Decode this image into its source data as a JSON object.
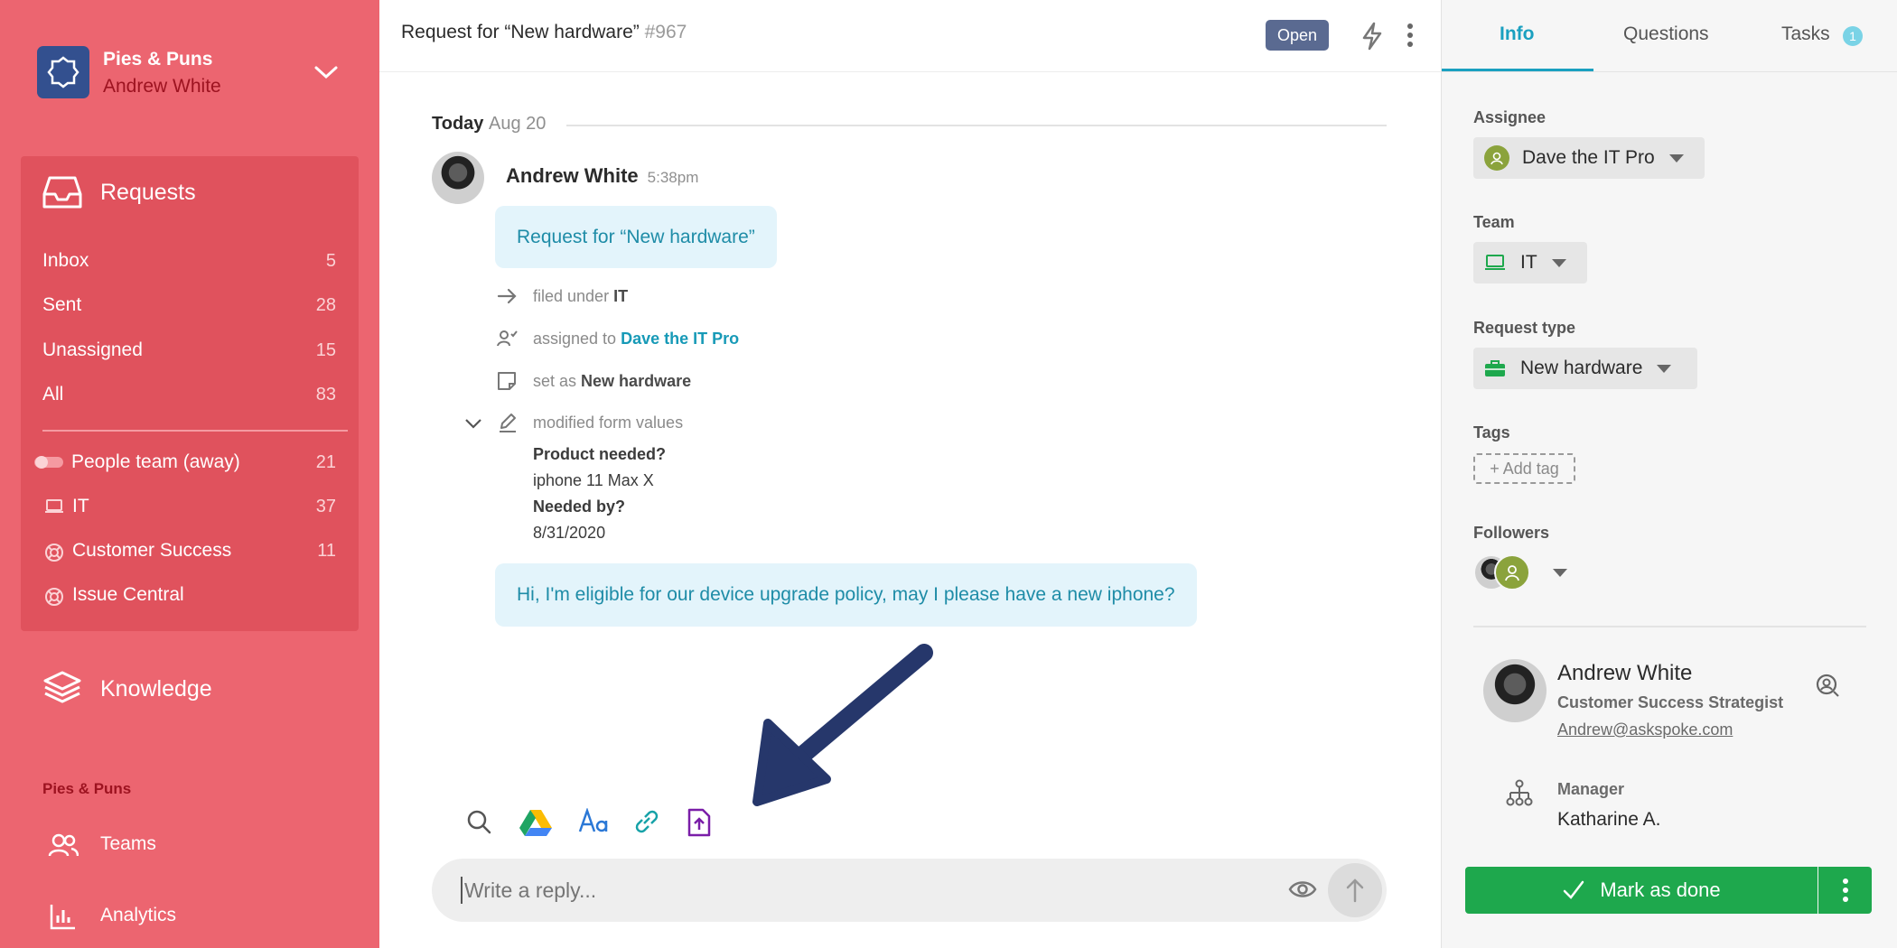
{
  "workspace": {
    "name": "Pies & Puns",
    "user": "Andrew White"
  },
  "sidebar": {
    "requests_label": "Requests",
    "items": [
      {
        "label": "Inbox",
        "count": "5"
      },
      {
        "label": "Sent",
        "count": "28"
      },
      {
        "label": "Unassigned",
        "count": "15"
      },
      {
        "label": "All",
        "count": "83"
      }
    ],
    "teams": [
      {
        "label": "People team (away)",
        "count": "21",
        "icon": "toggle-off-icon"
      },
      {
        "label": "IT",
        "count": "37",
        "icon": "laptop-icon"
      },
      {
        "label": "Customer Success",
        "count": "11",
        "icon": "lifebuoy-icon"
      },
      {
        "label": "Issue Central",
        "count": "",
        "icon": "lifebuoy-icon"
      }
    ],
    "knowledge_label": "Knowledge",
    "section_label": "Pies & Puns",
    "teams_label": "Teams",
    "analytics_label": "Analytics"
  },
  "header": {
    "title": "Request for “New hardware”",
    "id": "#967",
    "status": "Open"
  },
  "conversation": {
    "day": "Today",
    "date": "Aug 20",
    "author": "Andrew White",
    "time": "5:38pm",
    "first_message": "Request for “New hardware”",
    "events": {
      "filed_prefix": "filed under",
      "filed_value": "IT",
      "assigned_prefix": "assigned to",
      "assigned_value": "Dave the IT Pro",
      "set_prefix": "set as",
      "set_value": "New hardware",
      "modified": "modified form values"
    },
    "form": {
      "q1": "Product needed?",
      "a1": "iphone 11 Max X",
      "q2": "Needed by?",
      "a2": "8/31/2020"
    },
    "second_message": "Hi, I'm eligible for our device upgrade policy, may I please have a new iphone?"
  },
  "composer": {
    "placeholder": "Write a reply..."
  },
  "right_panel": {
    "tabs": {
      "info": "Info",
      "questions": "Questions",
      "tasks": "Tasks",
      "tasks_badge": "1"
    },
    "assignee_label": "Assignee",
    "assignee": "Dave the IT Pro",
    "team_label": "Team",
    "team": "IT",
    "request_type_label": "Request type",
    "request_type": "New hardware",
    "tags_label": "Tags",
    "add_tag": "+ Add tag",
    "followers_label": "Followers",
    "profile": {
      "name": "Andrew White",
      "role": "Customer Success Strategist",
      "email": "Andrew@askspoke.com"
    },
    "manager_label": "Manager",
    "manager": "Katharine A.",
    "done_button": "Mark as done"
  },
  "colors": {
    "sidebar": "#ec6570",
    "accent": "#1aa0c0",
    "done": "#1ea84d",
    "status": "#5a6a91",
    "arrow": "#26376b"
  }
}
